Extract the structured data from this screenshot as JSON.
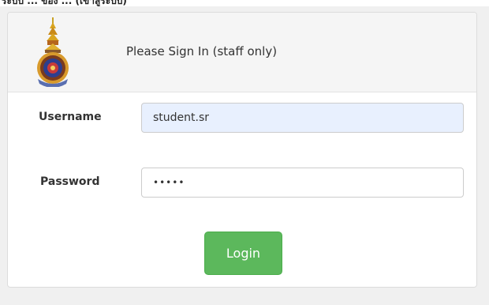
{
  "top_strip": {
    "text": "ระบบ ... ของ ... (เข้าสู่ระบบ)"
  },
  "panel": {
    "title": "Please Sign In (staff only)"
  },
  "form": {
    "username_label": "Username",
    "username_value": "student.sr",
    "password_label": "Password",
    "password_value": "•••••",
    "login_label": "Login"
  },
  "colors": {
    "login_button": "#5cb85c",
    "autofill_background": "#e8f0fe",
    "header_background": "#f5f5f5"
  },
  "icons": {
    "logo": "university-emblem-icon"
  }
}
